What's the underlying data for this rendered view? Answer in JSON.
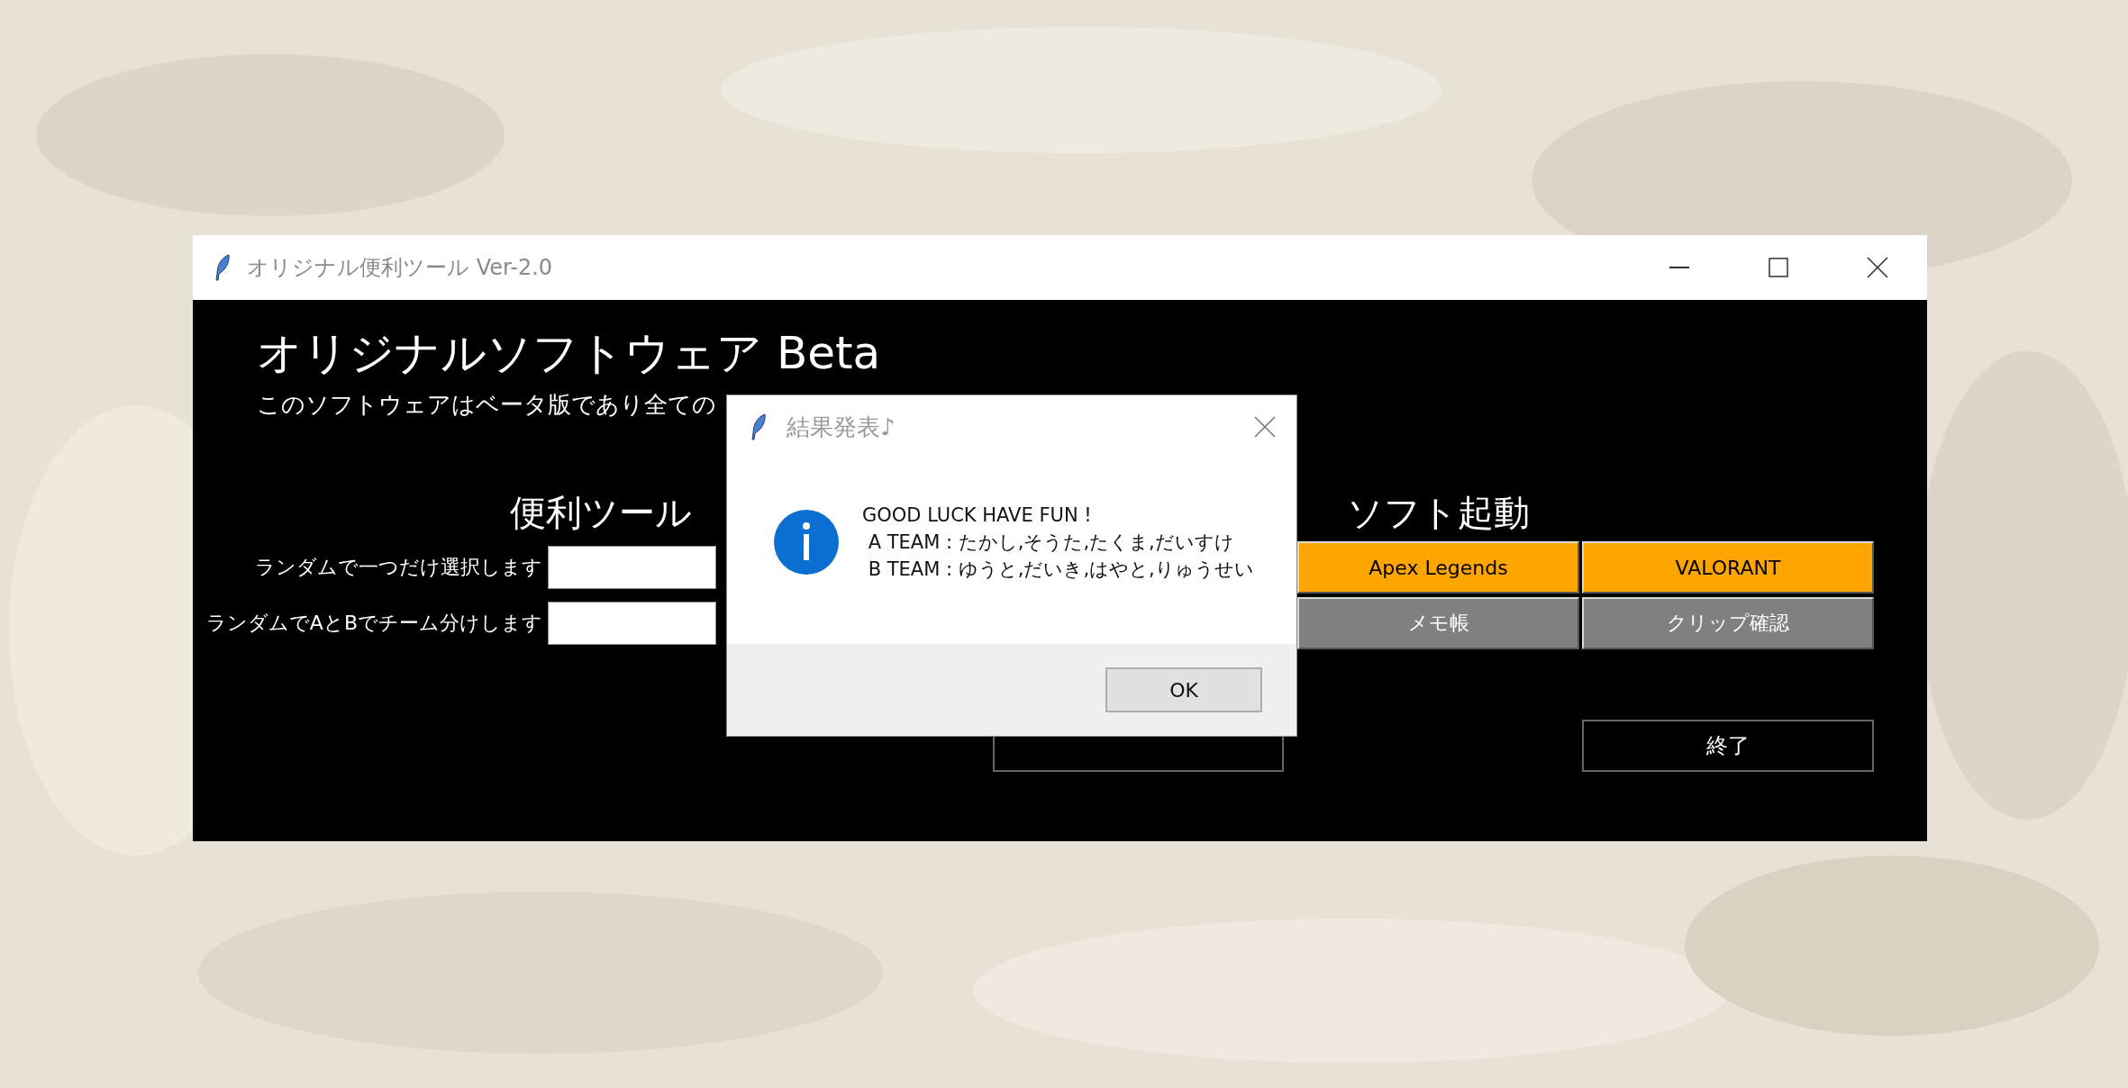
{
  "main_window": {
    "title": "オリジナル便利ツール Ver-2.0",
    "heading": "オリジナルソフトウェア Beta",
    "subtitle": "このソフトウェアはベータ版であり全ての",
    "tools": {
      "title": "便利ツール",
      "rows": [
        {
          "label": "ランダムで一つだけ選択します"
        },
        {
          "label": "ランダムでAとBでチーム分けします"
        }
      ]
    },
    "launch": {
      "title": "ソフト起動",
      "buttons": [
        {
          "label": "Apex Legends",
          "color": "#ffa500"
        },
        {
          "label": "VALORANT",
          "color": "#ffa500"
        },
        {
          "label": "メモ帳",
          "color": "#808080"
        },
        {
          "label": "クリップ確認",
          "color": "#808080"
        }
      ]
    },
    "quit_button": "終了"
  },
  "dialog": {
    "title": "結果発表♪",
    "message": "GOOD LUCK HAVE FUN !\n A TEAM : たかし,そうた,たくま,だいすけ\n B TEAM : ゆうと,だいき,はやと,りゅうせい",
    "ok_button": "OK"
  }
}
